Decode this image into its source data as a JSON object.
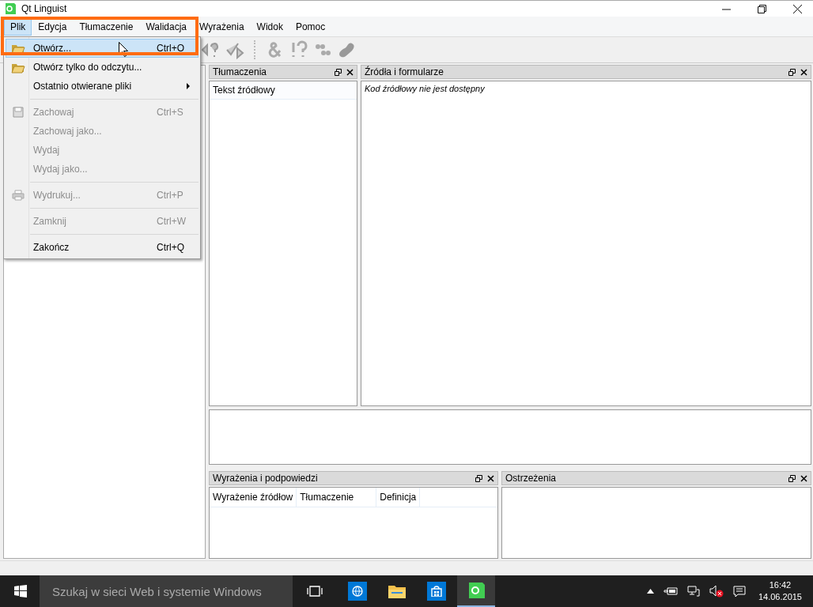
{
  "window": {
    "title": "Qt Linguist"
  },
  "menubar": [
    {
      "label": "Plik",
      "selected": true
    },
    {
      "label": "Edycja",
      "selected": false
    },
    {
      "label": "Tłumaczenie",
      "selected": false
    },
    {
      "label": "Walidacja",
      "selected": false
    },
    {
      "label": "Wyrażenia",
      "selected": false
    },
    {
      "label": "Widok",
      "selected": false
    },
    {
      "label": "Pomoc",
      "selected": false
    }
  ],
  "file_menu": {
    "items": [
      {
        "kind": "item",
        "label": "Otwórz...",
        "shortcut": "Ctrl+O",
        "disabled": false,
        "selected": true
      },
      {
        "kind": "item",
        "label": "Otwórz tylko do odczytu...",
        "disabled": false,
        "selected": false
      },
      {
        "kind": "submenu",
        "label": "Ostatnio otwierane pliki",
        "disabled": false,
        "selected": false
      },
      {
        "kind": "separator"
      },
      {
        "kind": "item",
        "label": "Zachowaj",
        "shortcut": "Ctrl+S",
        "disabled": true,
        "selected": false
      },
      {
        "kind": "item",
        "label": "Zachowaj jako...",
        "disabled": true,
        "selected": false
      },
      {
        "kind": "item",
        "label": "Wydaj",
        "disabled": true,
        "selected": false
      },
      {
        "kind": "item",
        "label": "Wydaj jako...",
        "disabled": true,
        "selected": false
      },
      {
        "kind": "separator"
      },
      {
        "kind": "item",
        "label": "Wydrukuj...",
        "shortcut": "Ctrl+P",
        "disabled": true,
        "selected": false
      },
      {
        "kind": "separator"
      },
      {
        "kind": "item",
        "label": "Zamknij",
        "shortcut": "Ctrl+W",
        "disabled": true,
        "selected": false
      },
      {
        "kind": "separator"
      },
      {
        "kind": "item",
        "label": "Zakończ",
        "shortcut": "Ctrl+Q",
        "disabled": false,
        "selected": false
      }
    ]
  },
  "translations_dock": {
    "title": "Tłumaczenia",
    "column": "Tekst źródłowy"
  },
  "sources_dock": {
    "title": "Źródła i formularze",
    "message": "Kod źródłowy nie jest dostępny"
  },
  "phrases_dock": {
    "title": "Wyrażenia i podpowiedzi",
    "columns": [
      "Wyrażenie źródłow",
      "Tłumaczenie",
      "Definicja"
    ]
  },
  "warnings_dock": {
    "title": "Ostrzeżenia"
  },
  "taskbar": {
    "search": {
      "placeholder": "Szukaj w sieci Web i systemie Windows"
    },
    "clock": {
      "time": "16:42",
      "date": "14.06.2015"
    }
  }
}
